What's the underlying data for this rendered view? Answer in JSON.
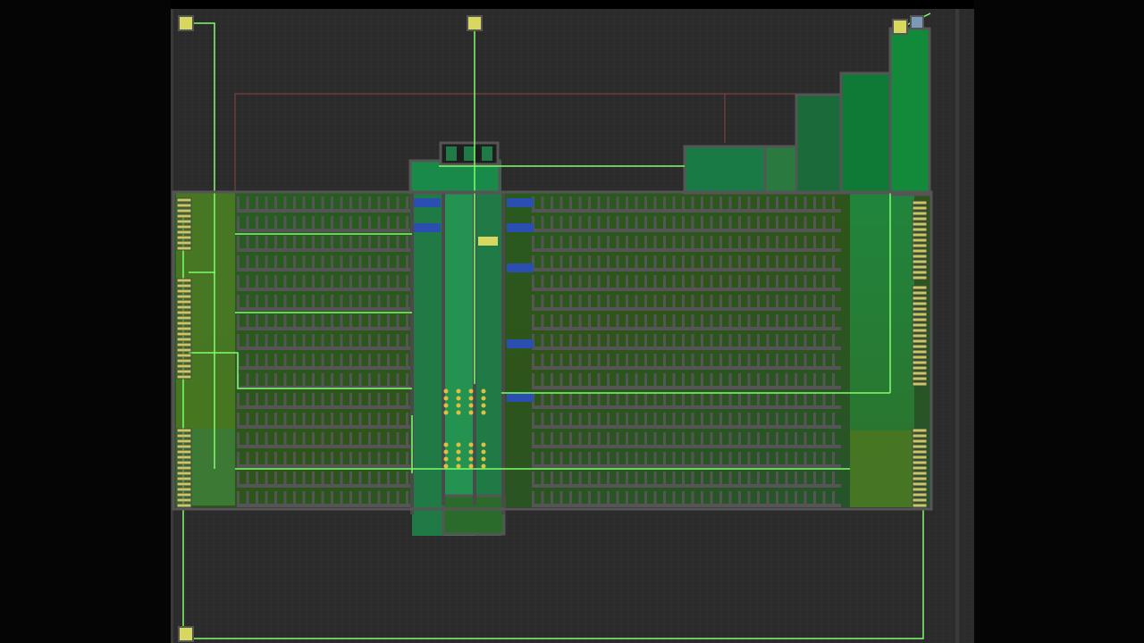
{
  "screen": {
    "title": "",
    "background_color": "#2b2b2b",
    "grid_color": "#323232",
    "wall_color": "#4a4a4a",
    "floor_dark": "#1e1e1e",
    "oxygen_green": "#1f7a45",
    "oxygen_light": "#2f9a55",
    "mixed_yellow_green": "#5a7a1a",
    "wire_color": "#7dff6a",
    "logic_color": "#9a5050",
    "water_color": "#2a4fb0",
    "battery_color": "#c8c860"
  },
  "map": {
    "description_free": true,
    "rows": 16,
    "pillar_columns": 37,
    "right_pillar_columns": 38,
    "ladder_shafts": 3,
    "battery_banks": [
      {
        "side": "left",
        "count": 3
      },
      {
        "side": "right",
        "count": 4
      }
    ],
    "generator_clusters": 2,
    "water_reservoirs": 8
  }
}
